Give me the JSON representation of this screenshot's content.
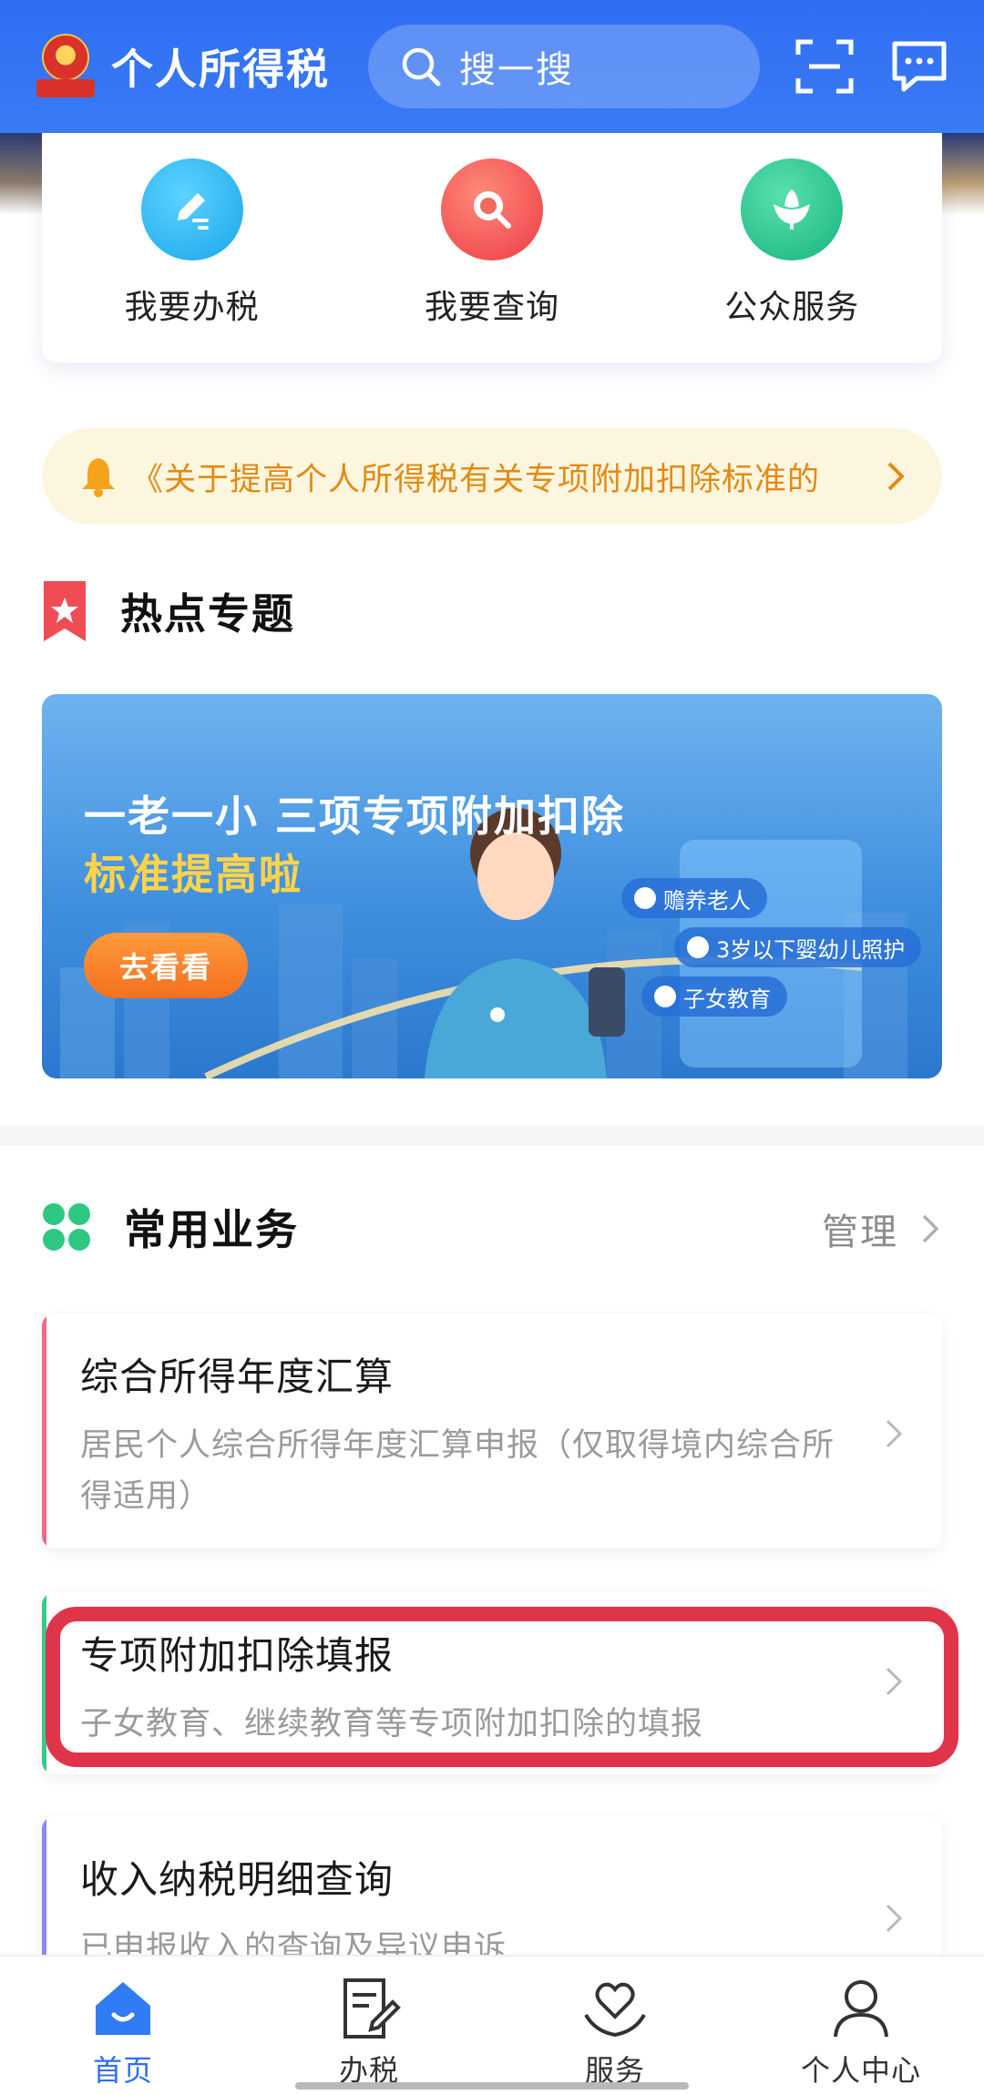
{
  "header": {
    "app_title": "个人所得税",
    "search_placeholder": "搜一搜",
    "brand_color": "#2f6ef3"
  },
  "quick_actions": [
    {
      "label": "我要办税",
      "icon": "pen-edit-icon",
      "color": "#1fb4f0"
    },
    {
      "label": "我要查询",
      "icon": "search-icon",
      "color": "#f04b47"
    },
    {
      "label": "公众服务",
      "icon": "lotus-icon",
      "color": "#22c08a"
    }
  ],
  "notice": {
    "text": "《关于提高个人所得税有关专项附加扣除标准的",
    "icon": "bell-icon"
  },
  "hot_topics": {
    "title": "热点专题",
    "banner": {
      "headline": "一老一小 三项专项附加扣除",
      "subheadline": "标准提高啦",
      "cta": "去看看",
      "tags": [
        "赡养老人",
        "3岁以下婴幼儿照护",
        "子女教育"
      ]
    }
  },
  "common_business": {
    "title": "常用业务",
    "manage_label": "管理",
    "items": [
      {
        "title": "综合所得年度汇算",
        "desc": "居民个人综合所得年度汇算申报（仅取得境内综合所得适用）",
        "accent": "#f06a86"
      },
      {
        "title": "专项附加扣除填报",
        "desc": "子女教育、继续教育等专项附加扣除的填报",
        "accent": "#37c98a"
      },
      {
        "title": "收入纳税明细查询",
        "desc": "已申报收入的查询及异议申诉",
        "accent": "#8f86f0"
      }
    ]
  },
  "bottom_nav": [
    {
      "label": "首页",
      "icon": "home-icon",
      "active": true
    },
    {
      "label": "办税",
      "icon": "document-edit-icon",
      "active": false
    },
    {
      "label": "服务",
      "icon": "heart-hands-icon",
      "active": false
    },
    {
      "label": "个人中心",
      "icon": "person-icon",
      "active": false
    }
  ]
}
